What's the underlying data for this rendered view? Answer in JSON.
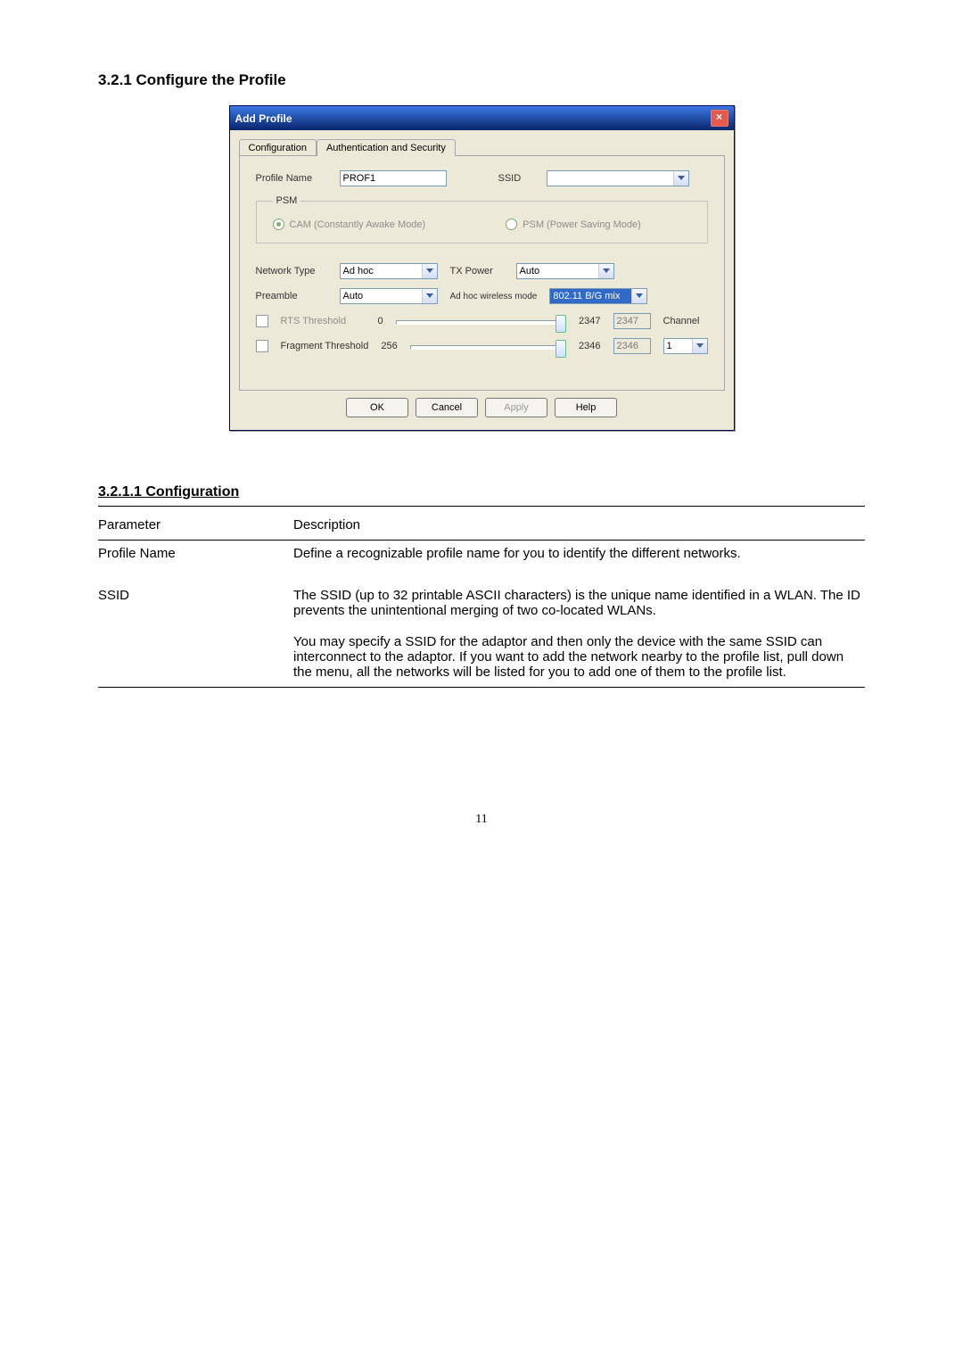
{
  "heading": "3.2.1  Configure the Profile",
  "dialog": {
    "title": "Add Profile",
    "tabs": [
      "Configuration",
      "Authentication and Security"
    ],
    "profile_name_label": "Profile Name",
    "profile_name_value": "PROF1",
    "ssid_label": "SSID",
    "ssid_value": "",
    "psm_legend": "PSM",
    "psm_cam": "CAM (Constantly Awake Mode)",
    "psm_psm": "PSM (Power Saving Mode)",
    "network_type_label": "Network Type",
    "network_type_value": "Ad hoc",
    "tx_power_label": "TX Power",
    "tx_power_value": "Auto",
    "preamble_label": "Preamble",
    "preamble_value": "Auto",
    "adhoc_mode_label": "Ad hoc wireless mode",
    "adhoc_mode_value": "802.11 B/G mix",
    "rts_label": "RTS Threshold",
    "rts_min": "0",
    "rts_val": "2347",
    "rts_box": "2347",
    "channel_label": "Channel",
    "frag_label": "Fragment Threshold",
    "frag_min": "256",
    "frag_val": "2346",
    "frag_box": "2346",
    "channel_value": "1",
    "btn_ok": "OK",
    "btn_cancel": "Cancel",
    "btn_apply": "Apply",
    "btn_help": "Help"
  },
  "section_heading": "3.2.1.1   Configuration",
  "table": {
    "h_param": "Parameter",
    "h_desc": "Description",
    "rows": [
      {
        "param": "Profile Name",
        "desc": "Define a recognizable profile name for you to identify the different networks."
      },
      {
        "param": "SSID",
        "desc1": "The SSID (up to 32 printable ASCII characters) is the unique name identified in a WLAN. The ID prevents the unintentional merging of two co-located WLANs.",
        "desc2": "You may specify a SSID for the adaptor and then only the device with the same SSID can interconnect to the adaptor. If you want to add the network nearby to the profile list, pull down the menu, all the networks will be listed for you to add one of them to the profile list."
      }
    ]
  },
  "page_number": "11"
}
